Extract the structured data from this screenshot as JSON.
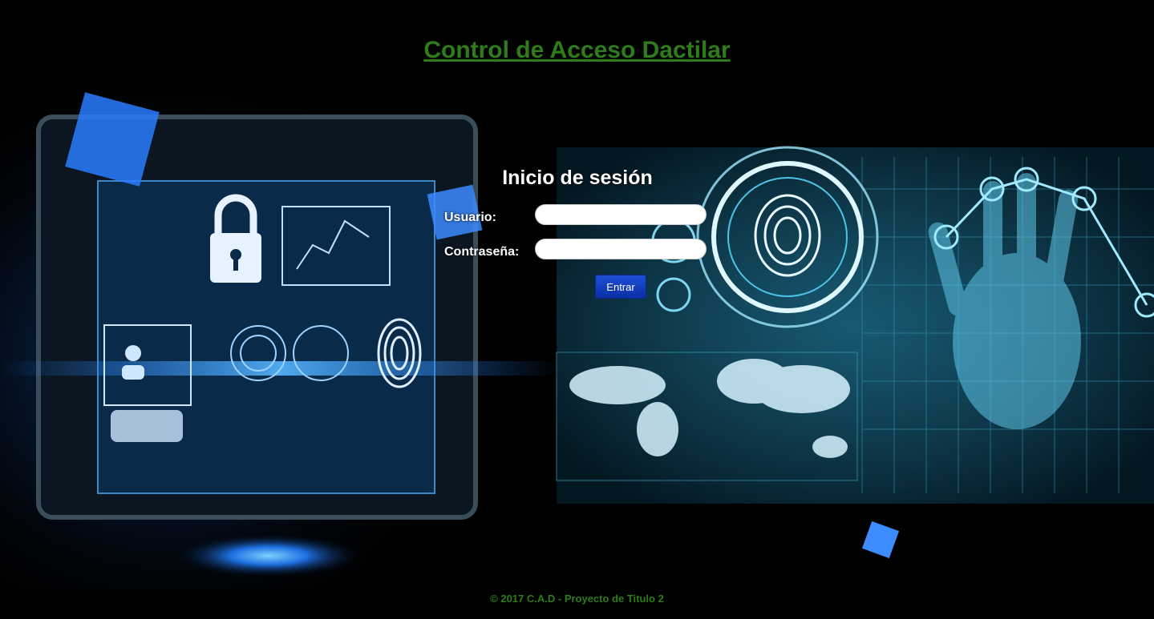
{
  "header": {
    "title": "Control de Acceso Dactilar"
  },
  "login": {
    "heading": "Inicio de sesión",
    "username_label": "Usuario:",
    "username_value": "",
    "password_label": "Contraseña:",
    "password_value": "",
    "submit_label": "Entrar"
  },
  "footer": {
    "text": "© 2017 C.A.D - Proyecto de Titulo 2"
  },
  "colors": {
    "title_green": "#2e7d1a",
    "button_blue": "#1f4fd6",
    "background": "#000000"
  }
}
